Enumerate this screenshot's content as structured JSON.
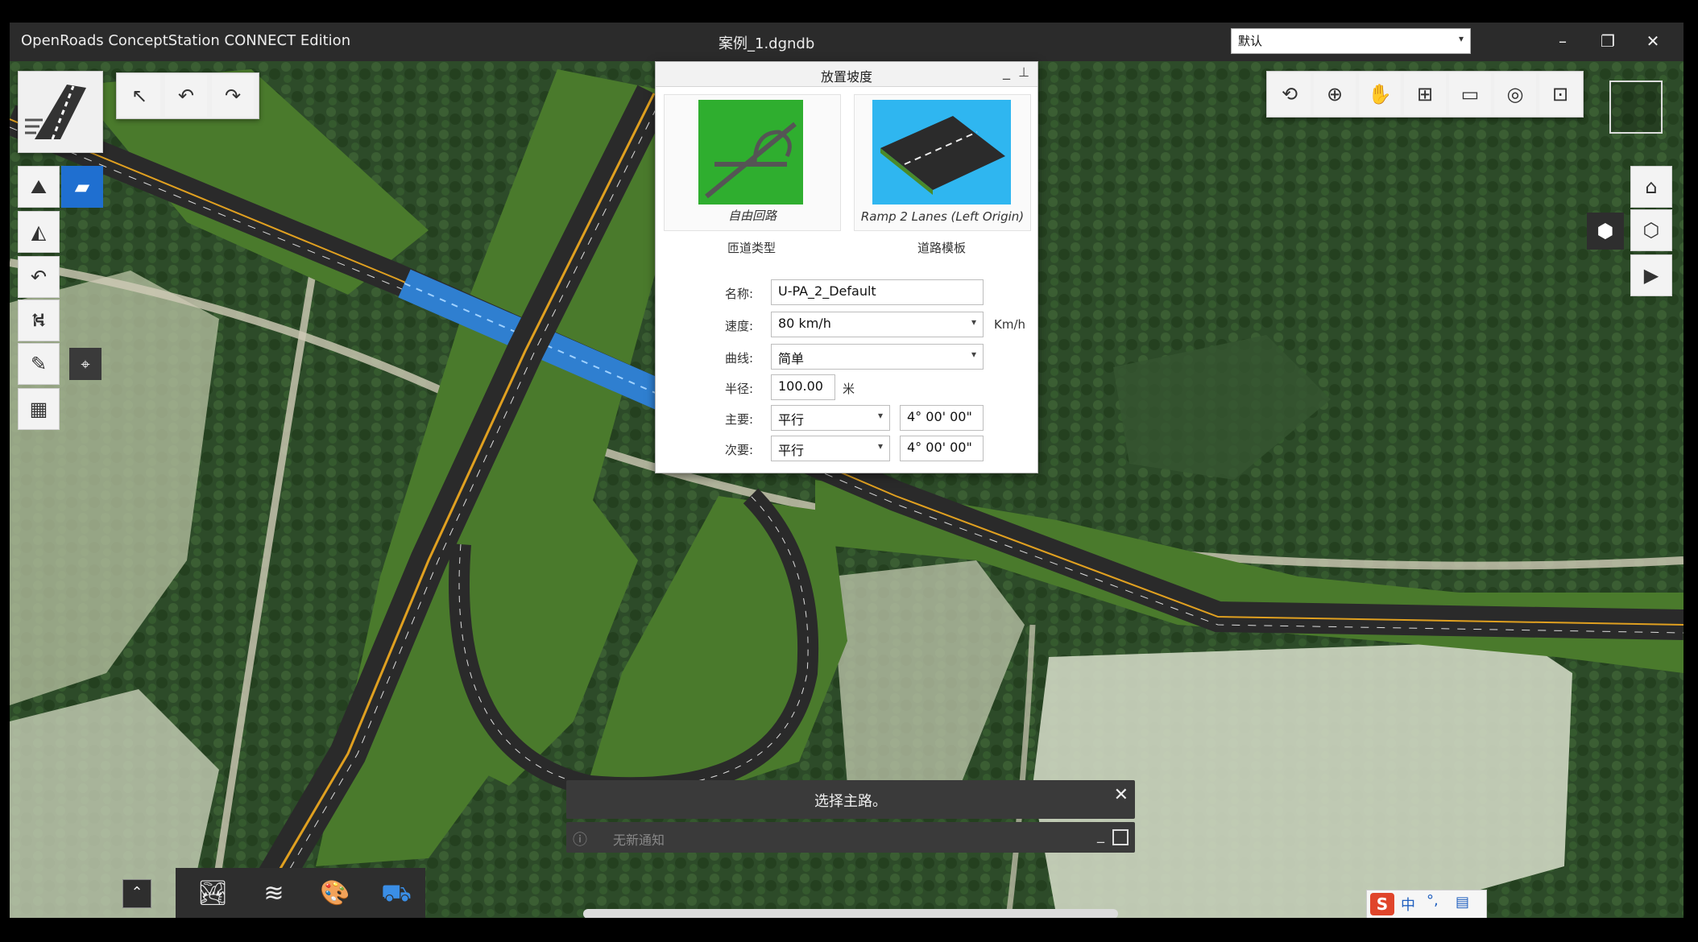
{
  "titlebar": {
    "app_title": "OpenRoads ConceptStation CONNECT Edition",
    "file_name": "案例_1.dgndb",
    "view_combo": "默认",
    "minimize": "–",
    "restore": "❐",
    "close": "✕"
  },
  "toolbar_top": {
    "select": "↖",
    "undo": "↶",
    "redo": "↷"
  },
  "view_toolbar": [
    "⟲",
    "⊕",
    "✋",
    "⊞",
    "▭",
    "◎",
    "⊡"
  ],
  "right_tools": [
    "⌂",
    "⬢",
    "⬡",
    "▶"
  ],
  "dialog": {
    "title": "放置坡度",
    "minimize": "_",
    "pin": "⊥",
    "card_left_caption": "自由回路",
    "card_right_caption": "Ramp 2 Lanes (Left Origin)",
    "under_left": "匝道类型",
    "under_right": "道路模板",
    "name_label": "名称:",
    "name_value": "U-PA_2_Default",
    "speed_label": "速度:",
    "speed_value": "80 km/h",
    "speed_unit": "Km/h",
    "curve_label": "曲线:",
    "curve_value": "简单",
    "radius_label": "半径:",
    "radius_value": "100.00",
    "radius_unit": "米",
    "major_label": "主要:",
    "major_value": "平行",
    "major_angle": "4° 00' 00\"",
    "minor_label": "次要:",
    "minor_value": "平行",
    "minor_angle": "4° 00' 00\""
  },
  "toast": {
    "message": "选择主路。",
    "close": "✕",
    "notify": "无新通知",
    "info": "ⓘ"
  },
  "ime": {
    "mode": "中"
  },
  "colors": {
    "road": "#2a2a2a",
    "lane_yellow": "#e0a020",
    "embankment": "#4a7a2c",
    "bridge": "#2f7fd0",
    "forest": "#2c4a28",
    "field": "#cfd7c2"
  }
}
